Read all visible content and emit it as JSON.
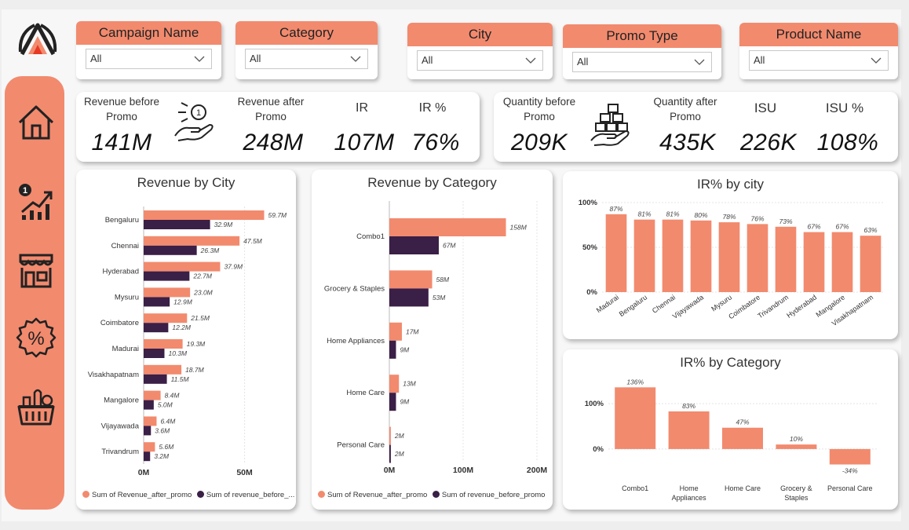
{
  "colors": {
    "accent": "#f28a6e",
    "before": "#3a1f47",
    "grid": "#e4e4e4"
  },
  "filters": [
    {
      "label": "Campaign Name",
      "value": "All"
    },
    {
      "label": "Category",
      "value": "All"
    },
    {
      "label": "City",
      "value": "All"
    },
    {
      "label": "Promo Type",
      "value": "All"
    },
    {
      "label": "Product Name",
      "value": "All"
    }
  ],
  "nav": {
    "icons": [
      "home-icon",
      "growth-chart-icon",
      "store-icon",
      "discount-percent-icon",
      "grocery-basket-icon"
    ]
  },
  "kpis": {
    "revenue_before": {
      "label": "Revenue before Promo",
      "value": "141M"
    },
    "revenue_after": {
      "label": "Revenue after Promo",
      "value": "248M"
    },
    "ir": {
      "label": "IR",
      "value": "107M"
    },
    "ir_pct": {
      "label": "IR %",
      "value": "76%"
    },
    "qty_before": {
      "label": "Quantity before Promo",
      "value": "209K"
    },
    "qty_after": {
      "label": "Quantity after Promo",
      "value": "435K"
    },
    "isu": {
      "label": "ISU",
      "value": "226K"
    },
    "isu_pct": {
      "label": "ISU %",
      "value": "108%"
    }
  },
  "chart_data": [
    {
      "id": "revenue_by_city",
      "type": "bar",
      "orientation": "horizontal",
      "title": "Revenue by City",
      "categories": [
        "Bengaluru",
        "Chennai",
        "Hyderabad",
        "Mysuru",
        "Coimbatore",
        "Madurai",
        "Visakhapatnam",
        "Mangalore",
        "Vijayawada",
        "Trivandrum"
      ],
      "series": [
        {
          "name": "Sum of Revenue_after_promo",
          "values": [
            59.7,
            47.5,
            37.9,
            23.0,
            21.5,
            19.3,
            18.7,
            8.4,
            6.4,
            5.6
          ],
          "labels": [
            "59.7M",
            "47.5M",
            "37.9M",
            "23.0M",
            "21.5M",
            "19.3M",
            "18.7M",
            "8.4M",
            "6.4M",
            "5.6M"
          ]
        },
        {
          "name": "Sum of revenue_before_...",
          "values": [
            32.9,
            26.3,
            22.7,
            12.9,
            12.2,
            10.3,
            11.5,
            5.0,
            3.6,
            3.2
          ],
          "labels": [
            "32.9M",
            "26.3M",
            "22.7M",
            "12.9M",
            "12.2M",
            "10.3M",
            "11.5M",
            "5.0M",
            "3.6M",
            "3.2M"
          ]
        }
      ],
      "xlim": [
        0,
        70
      ],
      "ticks": [
        {
          "v": 0,
          "label": "0M"
        },
        {
          "v": 50,
          "label": "50M"
        }
      ],
      "legend": "bottom"
    },
    {
      "id": "revenue_by_category",
      "type": "bar",
      "orientation": "horizontal",
      "title": "Revenue by Category",
      "categories": [
        "Combo1",
        "Grocery & Staples",
        "Home Appliances",
        "Home Care",
        "Personal Care"
      ],
      "series": [
        {
          "name": "Sum of Revenue_after_promo",
          "values": [
            158,
            58,
            17,
            13,
            2
          ],
          "labels": [
            "158M",
            "58M",
            "17M",
            "13M",
            "2M"
          ]
        },
        {
          "name": "Sum of revenue_before_promo",
          "values": [
            67,
            53,
            9,
            9,
            2
          ],
          "labels": [
            "67M",
            "53M",
            "9M",
            "9M",
            "2M"
          ]
        }
      ],
      "xlim": [
        0,
        200
      ],
      "ticks": [
        {
          "v": 0,
          "label": "0M"
        },
        {
          "v": 100,
          "label": "100M"
        },
        {
          "v": 200,
          "label": "200M"
        }
      ],
      "legend": "bottom"
    },
    {
      "id": "ir_pct_by_city",
      "type": "bar",
      "title": "IR% by city",
      "categories": [
        "Madurai",
        "Bengaluru",
        "Chennai",
        "Vijayawada",
        "Mysuru",
        "Coimbatore",
        "Trivandrum",
        "Hyderabad",
        "Mangalore",
        "Visakhapatnam"
      ],
      "values": [
        87,
        81,
        81,
        80,
        78,
        76,
        73,
        67,
        67,
        63
      ],
      "labels": [
        "87%",
        "81%",
        "81%",
        "80%",
        "78%",
        "76%",
        "73%",
        "67%",
        "67%",
        "63%"
      ],
      "ylim": [
        0,
        100
      ],
      "ticks": [
        {
          "v": 0,
          "label": "0%"
        },
        {
          "v": 50,
          "label": "50%"
        },
        {
          "v": 100,
          "label": "100%"
        }
      ]
    },
    {
      "id": "ir_pct_by_category",
      "type": "bar",
      "title": "IR% by Category",
      "categories": [
        "Combo1",
        "Home Appliances",
        "Home Care",
        "Grocery & Staples",
        "Personal Care"
      ],
      "category_lines": [
        [
          "Combo1"
        ],
        [
          "Home",
          "Appliances"
        ],
        [
          "Home Care"
        ],
        [
          "Grocery &",
          "Staples"
        ],
        [
          "Personal Care"
        ]
      ],
      "values": [
        136,
        83,
        47,
        10,
        -34
      ],
      "labels": [
        "136%",
        "83%",
        "47%",
        "10%",
        "-34%"
      ],
      "ylim": [
        -40,
        140
      ],
      "ticks": [
        {
          "v": 0,
          "label": "0%"
        },
        {
          "v": 100,
          "label": "100%"
        }
      ]
    }
  ]
}
